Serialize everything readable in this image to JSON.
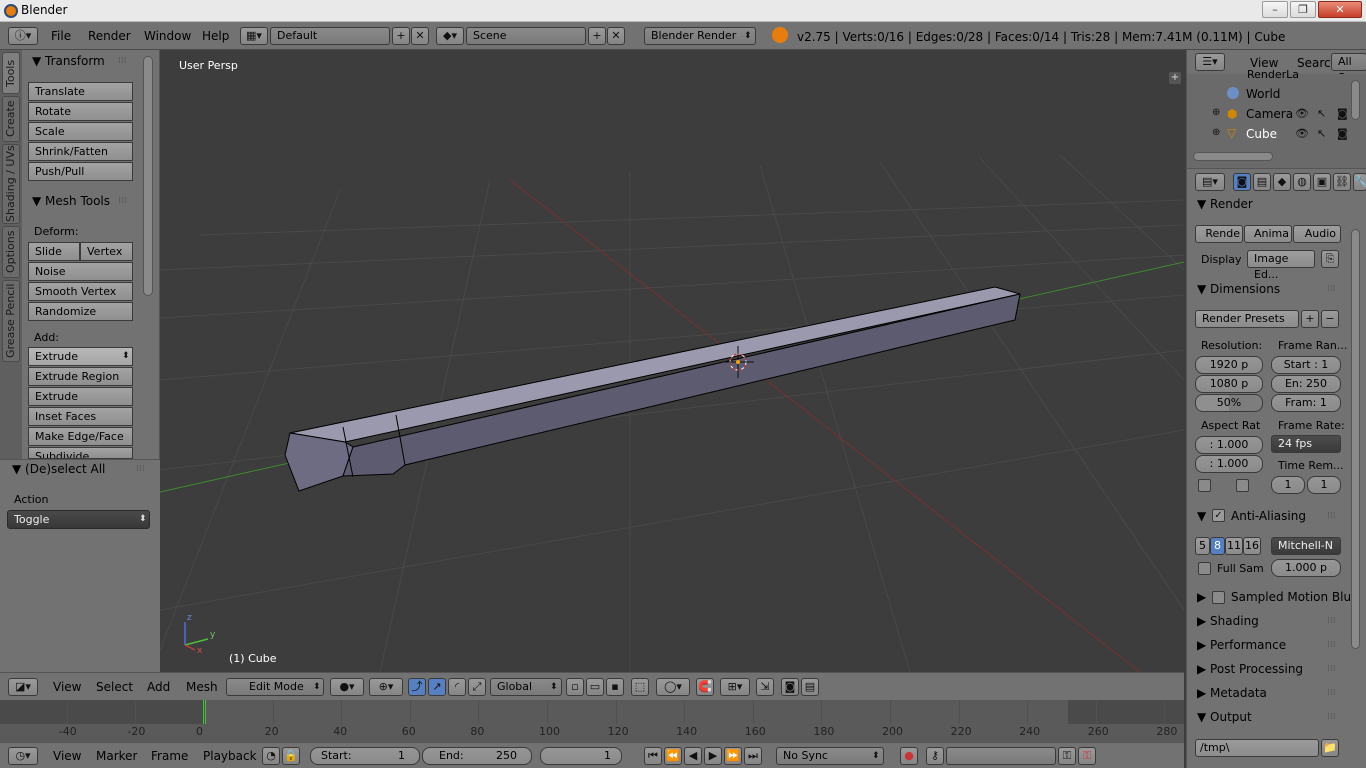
{
  "window": {
    "title": "Blender",
    "min": "–",
    "max": "❐",
    "close": "✕"
  },
  "info": {
    "menus": [
      "File",
      "Render",
      "Window",
      "Help"
    ],
    "screen": "Default",
    "scene": "Scene",
    "engine": "Blender Render",
    "stats": "v2.75 | Verts:0/16 | Edges:0/28 | Faces:0/14 | Tris:28 | Mem:7.41M (0.11M) | Cube"
  },
  "toolshelf": {
    "tabs": [
      "Tools",
      "Create",
      "Shading / UVs",
      "Options",
      "Grease Pencil"
    ],
    "transform_header": "Transform",
    "transform_buttons": [
      "Translate",
      "Rotate",
      "Scale",
      "Shrink/Fatten",
      "Push/Pull"
    ],
    "meshtools_header": "Mesh Tools",
    "deform_label": "Deform:",
    "deform_buttons": [
      "Slide Ed",
      "Vertex",
      "Noise",
      "Smooth Vertex",
      "Randomize"
    ],
    "add_label": "Add:",
    "extrude_select": "Extrude",
    "add_buttons": [
      "Extrude Region",
      "Extrude Individual",
      "Inset Faces",
      "Make Edge/Face",
      "Subdivide"
    ],
    "operator_header": "(De)select All",
    "action_label": "Action",
    "action_value": "Toggle"
  },
  "viewport": {
    "label": "User Persp",
    "object": "(1) Cube",
    "axis_x": "x",
    "axis_y": "y",
    "axis_z": "z"
  },
  "view_header": {
    "menus": [
      "View",
      "Select",
      "Add",
      "Mesh"
    ],
    "mode": "Edit Mode",
    "orientation": "Global"
  },
  "timeline": {
    "ticks": [
      -40,
      -20,
      0,
      20,
      40,
      60,
      80,
      100,
      120,
      140,
      160,
      180,
      200,
      220,
      240,
      260,
      280
    ],
    "current_frame": 0,
    "menus": [
      "View",
      "Marker",
      "Frame",
      "Playback"
    ],
    "start_label": "Start:",
    "start": "1",
    "end_label": "End:",
    "end": "250",
    "current": "1",
    "sync": "No Sync"
  },
  "outliner": {
    "menus": [
      "View",
      "Search"
    ],
    "filter": "All Sc",
    "items": [
      "RenderLa",
      "World",
      "Camera",
      "Cube"
    ]
  },
  "properties": {
    "render_header": "Render",
    "render_buttons": [
      "Rende",
      "Anima",
      "Audio"
    ],
    "display_label": "Display",
    "display_value": "Image Ed...",
    "dimensions_header": "Dimensions",
    "presets": "Render Presets",
    "resolution_label": "Resolution:",
    "res_x": "1920 p",
    "res_y": "1080 p",
    "res_pct": "50%",
    "frame_range_label": "Frame Ran...",
    "start": "Start : 1",
    "end": "En: 250",
    "step": "Fram: 1",
    "aspect_label": "Aspect Rat",
    "aspect_x": ": 1.000",
    "aspect_y": ": 1.000",
    "frame_rate_label": "Frame Rate:",
    "fps": "24 fps",
    "time_remap_label": "Time Rem...",
    "remap_old": "1",
    "remap_new": "1",
    "aa_header": "Anti-Aliasing",
    "aa_samples": [
      "5",
      "8",
      "11",
      "16"
    ],
    "aa_filter": "Mitchell-N",
    "full_sample": "Full Sam",
    "filter_size": "1.000 p",
    "sections": [
      "Sampled Motion Blur",
      "Shading",
      "Performance",
      "Post Processing",
      "Metadata"
    ],
    "output_header": "Output",
    "output_path": "/tmp\\"
  },
  "colors": {
    "accent": "#5680c2",
    "frame_line": "#44c23b",
    "x_axis": "#c43c3c",
    "y_axis": "#4ec03a",
    "mesh": "#8e8c9e"
  }
}
